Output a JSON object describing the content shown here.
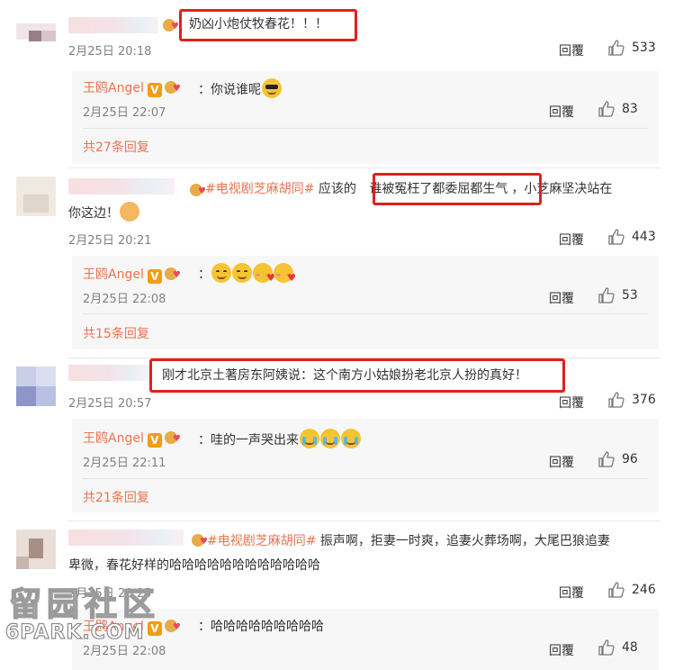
{
  "comments": [
    {
      "text": "奶凶小炮仗牧春花！！！",
      "date": "2月25日 20:18",
      "reply_label": "回覆",
      "likes": "533",
      "reply": {
        "author": "王鸥Angel",
        "text": "你说谁呢",
        "emoji": [
          "cool-sunglasses-emoji"
        ],
        "date": "2月25日 22:07",
        "reply_label": "回覆",
        "likes": "83"
      },
      "more": "共27条回复"
    },
    {
      "topic": "#电视剧芝麻胡同#",
      "text_before": " 应该的",
      "text_highlight": "谁被冤枉了都委屈都生气",
      "text_after": "，小芝麻坚决站在",
      "text_line2": "你这边！",
      "emoji": [
        "handshake-emoji"
      ],
      "date": "2月25日 20:21",
      "reply_label": "回覆",
      "likes": "443",
      "reply": {
        "author": "王鸥Angel",
        "text": "",
        "emoji": [
          "smile-emoji",
          "smile-emoji",
          "heart-kiss-emoji",
          "heart-kiss-emoji"
        ],
        "date": "2月25日 22:08",
        "reply_label": "回覆",
        "likes": "53"
      },
      "more": "共15条回复"
    },
    {
      "text": "刚才北京土著房东阿姨说：这个南方小姑娘扮老北京人扮的真好！",
      "date": "2月25日 20:57",
      "reply_label": "回覆",
      "likes": "376",
      "reply": {
        "author": "王鸥Angel",
        "text": "哇的一声哭出来",
        "emoji": [
          "crying-emoji",
          "crying-emoji",
          "crying-emoji"
        ],
        "date": "2月25日 22:11",
        "reply_label": "回覆",
        "likes": "96"
      },
      "more": "共21条回复"
    },
    {
      "topic": "#电视剧芝麻胡同#",
      "text_line1": " 振声啊，拒妻一时爽，追妻火葬场啊，大尾巴狼追妻",
      "text_line2": "卑微，春花好样的哈哈哈哈哈哈哈哈哈哈哈哈",
      "date": "2月25日 20:25",
      "reply_label": "回覆",
      "likes": "246",
      "reply": {
        "author": "王鸥Angel",
        "text": "哈哈哈哈哈哈哈哈哈",
        "date": "2月25日 22:08",
        "reply_label": "回覆",
        "likes": "48"
      }
    }
  ],
  "watermark": {
    "cn": "留园社区",
    "en": "6PARK.COM"
  },
  "colors": {
    "accent": "#eb7350",
    "highlight_box": "#e0211b",
    "meta": "#808080",
    "reply_bg": "#f7f7f7"
  }
}
